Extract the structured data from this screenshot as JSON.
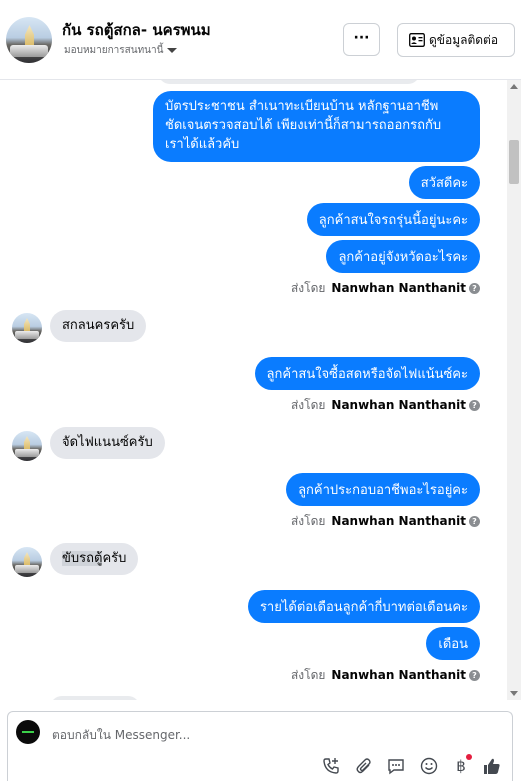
{
  "header": {
    "page_name": "กัน รถตู้สกล- นครพนม",
    "assigned_label": "มอบหมายการสนทนานี้",
    "more_label": "···",
    "contact_button_label": "ดูข้อมูลติดต่อ"
  },
  "conversation": {
    "sender_prefix": "ส่งโดย",
    "sender_name": "Nanwhan Nanthanit",
    "help_mark": "?",
    "messages": [
      {
        "dir": "out",
        "lines": [
          "บัตรประชาชน สำเนาทะเบียนบ้าน หลักฐานอาชีพ",
          "ชัดเจนตรวจสอบได้ เพียงเท่านี้ก็สามารถออกรถกับ",
          "เราได้แล้วคับ"
        ]
      },
      {
        "dir": "out",
        "text": "สวัสดีคะ"
      },
      {
        "dir": "out",
        "text": "ลูกค้าสนใจรถรุ่นนี้อยู่นะคะ"
      },
      {
        "dir": "out",
        "text": "ลูกค้าอยู่จังหวัดอะไรคะ"
      },
      {
        "dir": "in",
        "text": "สกลนครครับ"
      },
      {
        "dir": "out",
        "text": "ลูกค้าสนใจซื้อสดหรือจัดไฟแน้นซ์คะ"
      },
      {
        "dir": "in",
        "text": "จัดไฟแนนซ์ครับ"
      },
      {
        "dir": "out",
        "text": "ลูกค้าประกอบอาชีพอะไรอยู่คะ"
      },
      {
        "dir": "in",
        "text_hl": "ขับรถตู้",
        "text_rest": "ครับ"
      },
      {
        "dir": "out",
        "text": "รายได้ต่อเดือนลูกค้ากี่บาทต่อเดือนคะ"
      },
      {
        "dir": "out",
        "text": "เดือน"
      }
    ]
  },
  "composer": {
    "placeholder": "ตอบกลับใน Messenger...",
    "tools": [
      "phone-plus-icon",
      "attachment-icon",
      "saved-reply-icon",
      "emoji-icon",
      "payment-icon",
      "like-icon"
    ],
    "payment_glyph": "฿",
    "like_glyph": "👍"
  },
  "colors": {
    "outgoing": "#0a7cff",
    "incoming": "#e4e6eb",
    "notification_dot": "#e41e3f"
  }
}
